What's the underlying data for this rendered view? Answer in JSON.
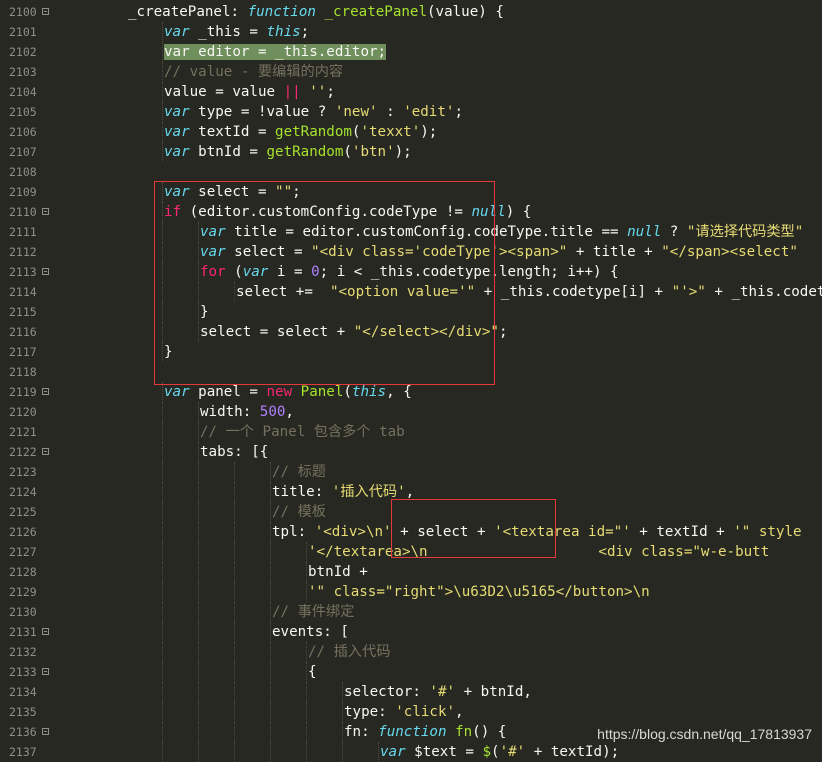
{
  "editor": {
    "lines": [
      {
        "num": "2100",
        "fold": true,
        "indent": 0,
        "tokens": [
          [
            "p",
            "_createPanel: "
          ],
          [
            "k",
            "function"
          ],
          [
            "p",
            " "
          ],
          [
            "f",
            "_createPanel"
          ],
          [
            "p",
            "(value) {"
          ]
        ]
      },
      {
        "num": "2101",
        "fold": false,
        "indent": 1,
        "tokens": [
          [
            "k",
            "var"
          ],
          [
            "p",
            " _this = "
          ],
          [
            "k",
            "this"
          ],
          [
            "p",
            ";"
          ]
        ]
      },
      {
        "num": "2102",
        "fold": false,
        "indent": 1,
        "tokens": [
          [
            "hl",
            "var editor = _this.editor;"
          ]
        ]
      },
      {
        "num": "2103",
        "fold": false,
        "indent": 1,
        "tokens": [
          [
            "c",
            "// value - 要编辑的内容"
          ]
        ]
      },
      {
        "num": "2104",
        "fold": false,
        "indent": 1,
        "tokens": [
          [
            "p",
            "value = value "
          ],
          [
            "r",
            "||"
          ],
          [
            "p",
            " "
          ],
          [
            "s",
            "''"
          ],
          [
            "p",
            ";"
          ]
        ]
      },
      {
        "num": "2105",
        "fold": false,
        "indent": 1,
        "tokens": [
          [
            "k",
            "var"
          ],
          [
            "p",
            " type = !value ? "
          ],
          [
            "s",
            "'new'"
          ],
          [
            "p",
            " : "
          ],
          [
            "s",
            "'edit'"
          ],
          [
            "p",
            ";"
          ]
        ]
      },
      {
        "num": "2106",
        "fold": false,
        "indent": 1,
        "tokens": [
          [
            "k",
            "var"
          ],
          [
            "p",
            " textId = "
          ],
          [
            "f",
            "getRandom"
          ],
          [
            "p",
            "("
          ],
          [
            "s",
            "'texxt'"
          ],
          [
            "p",
            ");"
          ]
        ]
      },
      {
        "num": "2107",
        "fold": false,
        "indent": 1,
        "tokens": [
          [
            "k",
            "var"
          ],
          [
            "p",
            " btnId = "
          ],
          [
            "f",
            "getRandom"
          ],
          [
            "p",
            "("
          ],
          [
            "s",
            "'btn'"
          ],
          [
            "p",
            ");"
          ]
        ]
      },
      {
        "num": "2108",
        "fold": false,
        "indent": 0,
        "tokens": []
      },
      {
        "num": "2109",
        "fold": false,
        "indent": 1,
        "tokens": [
          [
            "k",
            "var"
          ],
          [
            "p",
            " select = "
          ],
          [
            "s",
            "\"\""
          ],
          [
            "p",
            ";"
          ]
        ]
      },
      {
        "num": "2110",
        "fold": true,
        "indent": 1,
        "tokens": [
          [
            "r",
            "if"
          ],
          [
            "p",
            " (editor.customConfig.codeType != "
          ],
          [
            "k",
            "null"
          ],
          [
            "p",
            ") {"
          ]
        ]
      },
      {
        "num": "2111",
        "fold": false,
        "indent": 2,
        "tokens": [
          [
            "k",
            "var"
          ],
          [
            "p",
            " title = editor.customConfig.codeType.title == "
          ],
          [
            "k",
            "null"
          ],
          [
            "p",
            " ? "
          ],
          [
            "s",
            "\"请选择代码类型\""
          ]
        ]
      },
      {
        "num": "2112",
        "fold": false,
        "indent": 2,
        "tokens": [
          [
            "k",
            "var"
          ],
          [
            "p",
            " select = "
          ],
          [
            "s",
            "\"<div class='codeType'><span>\""
          ],
          [
            "p",
            " + title + "
          ],
          [
            "s",
            "\"</span><select\""
          ]
        ]
      },
      {
        "num": "2113",
        "fold": true,
        "indent": 2,
        "tokens": [
          [
            "r",
            "for"
          ],
          [
            "p",
            " ("
          ],
          [
            "k",
            "var"
          ],
          [
            "p",
            " i = "
          ],
          [
            "n",
            "0"
          ],
          [
            "p",
            "; i < _this.codetype.length; i++) {"
          ]
        ]
      },
      {
        "num": "2114",
        "fold": false,
        "indent": 3,
        "tokens": [
          [
            "p",
            "select +=  "
          ],
          [
            "s",
            "\"<option value='\""
          ],
          [
            "p",
            " + _this.codetype[i] + "
          ],
          [
            "s",
            "\"'>\""
          ],
          [
            "p",
            " + _this.codetype"
          ]
        ]
      },
      {
        "num": "2115",
        "fold": false,
        "indent": 2,
        "tokens": [
          [
            "p",
            "}"
          ]
        ]
      },
      {
        "num": "2116",
        "fold": false,
        "indent": 2,
        "tokens": [
          [
            "p",
            "select = select + "
          ],
          [
            "s",
            "\"</select></div>\""
          ],
          [
            "p",
            ";"
          ]
        ]
      },
      {
        "num": "2117",
        "fold": false,
        "indent": 1,
        "tokens": [
          [
            "p",
            "}"
          ]
        ]
      },
      {
        "num": "2118",
        "fold": false,
        "indent": 0,
        "tokens": []
      },
      {
        "num": "2119",
        "fold": true,
        "indent": 1,
        "tokens": [
          [
            "k",
            "var"
          ],
          [
            "p",
            " panel = "
          ],
          [
            "r",
            "new"
          ],
          [
            "p",
            " "
          ],
          [
            "f",
            "Panel"
          ],
          [
            "p",
            "("
          ],
          [
            "k",
            "this"
          ],
          [
            "p",
            ", {"
          ]
        ]
      },
      {
        "num": "2120",
        "fold": false,
        "indent": 2,
        "tokens": [
          [
            "p",
            "width: "
          ],
          [
            "n",
            "500"
          ],
          [
            "p",
            ","
          ]
        ]
      },
      {
        "num": "2121",
        "fold": false,
        "indent": 2,
        "tokens": [
          [
            "c",
            "// 一个 Panel 包含多个 tab"
          ]
        ]
      },
      {
        "num": "2122",
        "fold": true,
        "indent": 2,
        "tokens": [
          [
            "p",
            "tabs: [{"
          ]
        ]
      },
      {
        "num": "2123",
        "fold": false,
        "indent": 4,
        "tokens": [
          [
            "c",
            "// 标题"
          ]
        ]
      },
      {
        "num": "2124",
        "fold": false,
        "indent": 4,
        "tokens": [
          [
            "p",
            "title: "
          ],
          [
            "s",
            "'插入代码'"
          ],
          [
            "p",
            ","
          ]
        ]
      },
      {
        "num": "2125",
        "fold": false,
        "indent": 4,
        "tokens": [
          [
            "c",
            "// 模板"
          ]
        ]
      },
      {
        "num": "2126",
        "fold": false,
        "indent": 4,
        "tokens": [
          [
            "p",
            "tpl: "
          ],
          [
            "s",
            "'<div>\\n'"
          ],
          [
            "p",
            " + select + "
          ],
          [
            "s",
            "'<textarea id=\"'"
          ],
          [
            "p",
            " + textId + "
          ],
          [
            "s",
            "'\" style"
          ]
        ]
      },
      {
        "num": "2127",
        "fold": false,
        "indent": 5,
        "tokens": [
          [
            "s",
            "'</textarea>\\n                    <div class=\"w-e-butt"
          ]
        ]
      },
      {
        "num": "2128",
        "fold": false,
        "indent": 5,
        "tokens": [
          [
            "p",
            "btnId +"
          ]
        ]
      },
      {
        "num": "2129",
        "fold": false,
        "indent": 5,
        "tokens": [
          [
            "s",
            "'\" class=\"right\">\\u63D2\\u5165</button>\\n"
          ]
        ]
      },
      {
        "num": "2130",
        "fold": false,
        "indent": 4,
        "tokens": [
          [
            "c",
            "// 事件绑定"
          ]
        ]
      },
      {
        "num": "2131",
        "fold": true,
        "indent": 4,
        "tokens": [
          [
            "p",
            "events: ["
          ]
        ]
      },
      {
        "num": "2132",
        "fold": false,
        "indent": 5,
        "tokens": [
          [
            "c",
            "// 插入代码"
          ]
        ]
      },
      {
        "num": "2133",
        "fold": true,
        "indent": 5,
        "tokens": [
          [
            "p",
            "{"
          ]
        ]
      },
      {
        "num": "2134",
        "fold": false,
        "indent": 6,
        "tokens": [
          [
            "p",
            "selector: "
          ],
          [
            "s",
            "'#'"
          ],
          [
            "p",
            " + btnId,"
          ]
        ]
      },
      {
        "num": "2135",
        "fold": false,
        "indent": 6,
        "tokens": [
          [
            "p",
            "type: "
          ],
          [
            "s",
            "'click'"
          ],
          [
            "p",
            ","
          ]
        ]
      },
      {
        "num": "2136",
        "fold": true,
        "indent": 6,
        "tokens": [
          [
            "p",
            "fn: "
          ],
          [
            "k",
            "function"
          ],
          [
            "p",
            " "
          ],
          [
            "f",
            "fn"
          ],
          [
            "p",
            "() {"
          ]
        ]
      },
      {
        "num": "2137",
        "fold": false,
        "indent": 7,
        "tokens": [
          [
            "k",
            "var"
          ],
          [
            "p",
            " $text = "
          ],
          [
            "f",
            "$"
          ],
          [
            "p",
            "("
          ],
          [
            "s",
            "'#'"
          ],
          [
            "p",
            " + textId);"
          ]
        ]
      }
    ]
  },
  "watermark": "https://blog.csdn.net/qq_17813937",
  "colors": {
    "background": "#272822",
    "plain": "#f8f8f2",
    "string": "#e6db74",
    "keyword": "#66d9ef",
    "comment": "#75715e",
    "operator": "#f92672",
    "function": "#a6e22e",
    "number": "#ae81ff",
    "selection": "#6f8f5d",
    "annotation_box": "#e5383b"
  }
}
